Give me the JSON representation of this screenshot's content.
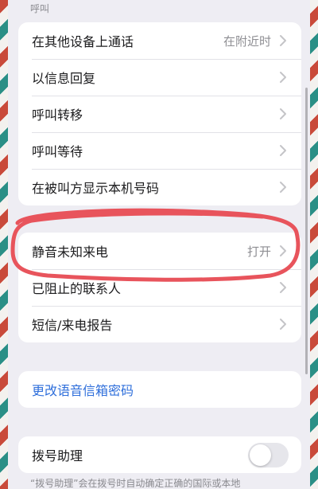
{
  "section": {
    "header": "呼叫"
  },
  "group1": {
    "items": [
      {
        "label": "在其他设备上通话",
        "value": "在附近时"
      },
      {
        "label": "以信息回复"
      },
      {
        "label": "呼叫转移"
      },
      {
        "label": "呼叫等待"
      },
      {
        "label": "在被叫方显示本机号码"
      }
    ]
  },
  "group2": {
    "items": [
      {
        "label": "静音未知来电",
        "value": "打开"
      },
      {
        "label": "已阻止的联系人"
      },
      {
        "label": "短信/来电报告"
      }
    ]
  },
  "voicemail": {
    "link_label": "更改语音信箱密码"
  },
  "dial_assist": {
    "label": "拨号助理",
    "enabled": false,
    "footnote": "“拨号助理”会在拨号时自动确定正确的国际或本地"
  },
  "colors": {
    "annotation": "#e8545c",
    "link": "#2f6fdb",
    "border_red": "#c94a3a",
    "border_teal": "#2a8f86"
  },
  "icons": {
    "chevron": "chevron-right-icon"
  }
}
